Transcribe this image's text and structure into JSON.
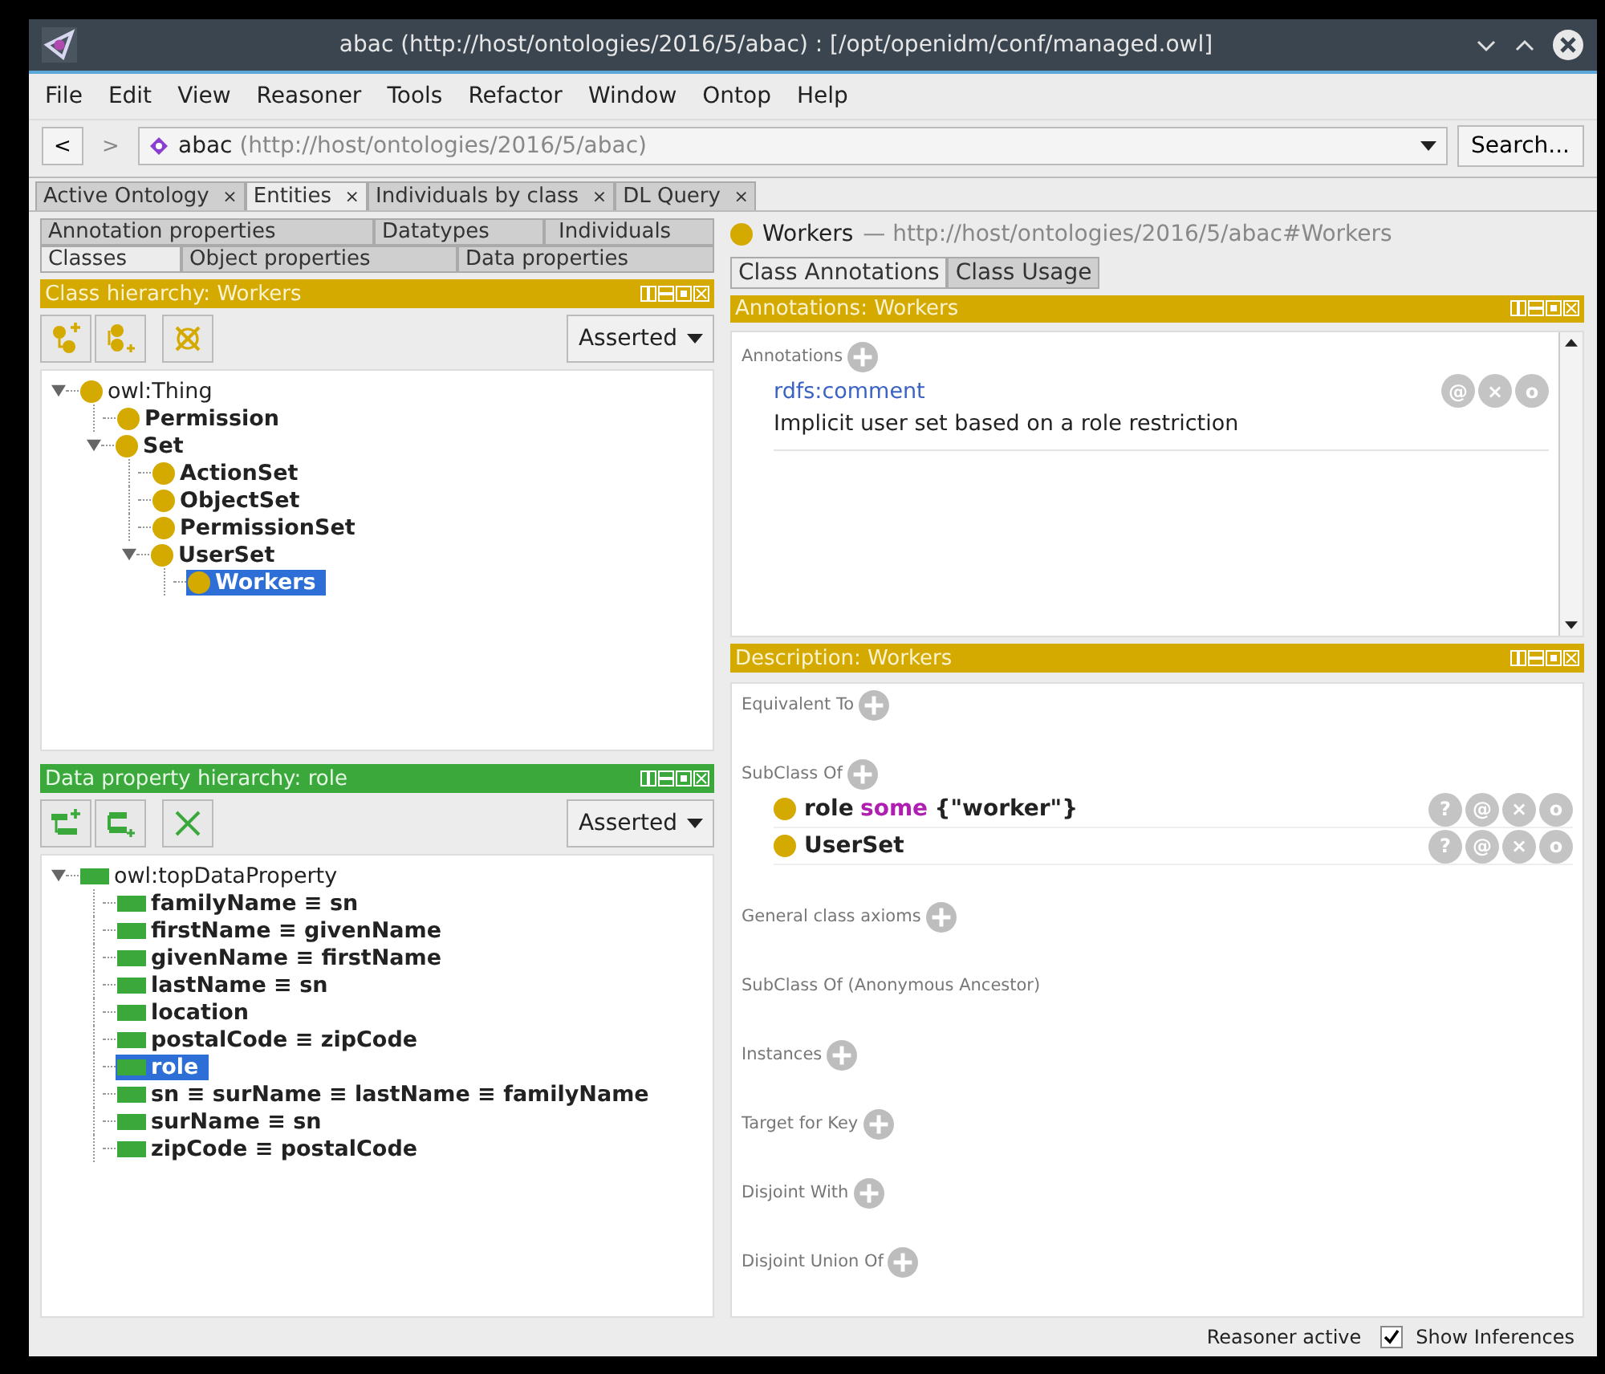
{
  "window": {
    "title": "abac (http://host/ontologies/2016/5/abac)  : [/opt/openidm/conf/managed.owl]"
  },
  "menu": [
    "File",
    "Edit",
    "View",
    "Reasoner",
    "Tools",
    "Refactor",
    "Window",
    "Ontop",
    "Help"
  ],
  "nav": {
    "back": "<",
    "forward": ">",
    "forward_disabled": true,
    "ontology_name": "abac",
    "ontology_iri": "(http://host/ontologies/2016/5/abac)",
    "search": "Search..."
  },
  "workspace_tabs": [
    {
      "label": "Active Ontology",
      "close": "×",
      "selected": false
    },
    {
      "label": "Entities",
      "close": "×",
      "selected": true
    },
    {
      "label": "Individuals by class",
      "close": "×",
      "selected": false
    },
    {
      "label": "DL Query",
      "close": "×",
      "selected": false
    }
  ],
  "entity_tabs": [
    [
      {
        "label": "Annotation properties",
        "selected": false
      },
      {
        "label": "Datatypes",
        "selected": false
      },
      {
        "label": "Individuals",
        "selected": false
      }
    ],
    [
      {
        "label": "Classes",
        "selected": true
      },
      {
        "label": "Object properties",
        "selected": false
      },
      {
        "label": "Data properties",
        "selected": false
      }
    ]
  ],
  "class_hierarchy": {
    "title": "Class hierarchy: Workers",
    "view": "Asserted",
    "tree": [
      {
        "label": "owl:Thing",
        "bold": false,
        "selected": false,
        "expanded": true,
        "children": [
          {
            "label": "Permission",
            "bold": true,
            "selected": false
          },
          {
            "label": "Set",
            "bold": true,
            "selected": false,
            "expanded": true,
            "children": [
              {
                "label": "ActionSet",
                "bold": true,
                "selected": false
              },
              {
                "label": "ObjectSet",
                "bold": true,
                "selected": false
              },
              {
                "label": "PermissionSet",
                "bold": true,
                "selected": false
              },
              {
                "label": "UserSet",
                "bold": true,
                "selected": false,
                "expanded": true,
                "children": [
                  {
                    "label": "Workers",
                    "bold": true,
                    "selected": true
                  }
                ]
              }
            ]
          }
        ]
      }
    ]
  },
  "data_property_hierarchy": {
    "title": "Data property hierarchy: role",
    "view": "Asserted",
    "tree": [
      {
        "label": "owl:topDataProperty",
        "bold": false,
        "selected": false,
        "expanded": true,
        "children": [
          {
            "label": "familyName ≡ sn",
            "bold": true,
            "selected": false
          },
          {
            "label": "firstName ≡ givenName",
            "bold": true,
            "selected": false
          },
          {
            "label": "givenName ≡ firstName",
            "bold": true,
            "selected": false
          },
          {
            "label": "lastName ≡ sn",
            "bold": true,
            "selected": false
          },
          {
            "label": "location",
            "bold": true,
            "selected": false
          },
          {
            "label": "postalCode ≡ zipCode",
            "bold": true,
            "selected": false
          },
          {
            "label": "role",
            "bold": true,
            "selected": true
          },
          {
            "label": "sn ≡ surName ≡ lastName ≡ familyName",
            "bold": true,
            "selected": false
          },
          {
            "label": "surName ≡ sn",
            "bold": true,
            "selected": false
          },
          {
            "label": "zipCode ≡ postalCode",
            "bold": true,
            "selected": false
          }
        ]
      }
    ]
  },
  "entity": {
    "name": "Workers",
    "iri": "— http://host/ontologies/2016/5/abac#Workers"
  },
  "detail_tabs": [
    {
      "label": "Class Annotations",
      "selected": true
    },
    {
      "label": "Class Usage",
      "selected": false
    }
  ],
  "annotations": {
    "title": "Annotations: Workers",
    "label": "Annotations",
    "items": [
      {
        "property": "rdfs:comment",
        "value": "Implicit user set based on a role restriction",
        "actions": [
          "@",
          "×",
          "o"
        ]
      }
    ]
  },
  "description": {
    "title": "Description: Workers",
    "sections": [
      {
        "label": "Equivalent To",
        "addable": true
      },
      {
        "label": "SubClass Of",
        "addable": true,
        "items": [
          {
            "segments": [
              {
                "text": "role",
                "kind": "name"
              },
              {
                "text": "some",
                "kind": "keyword"
              },
              {
                "text": "{\"worker\"}",
                "kind": "name"
              }
            ],
            "actions": [
              "?",
              "@",
              "×",
              "o"
            ]
          },
          {
            "segments": [
              {
                "text": "UserSet",
                "kind": "name"
              }
            ],
            "actions": [
              "?",
              "@",
              "×",
              "o"
            ]
          }
        ]
      },
      {
        "label": "General class axioms",
        "addable": true
      },
      {
        "label": "SubClass Of (Anonymous Ancestor)",
        "addable": false
      },
      {
        "label": "Instances",
        "addable": true
      },
      {
        "label": "Target for Key",
        "addable": true
      },
      {
        "label": "Disjoint With",
        "addable": true
      },
      {
        "label": "Disjoint Union Of",
        "addable": true
      }
    ]
  },
  "status": {
    "reasoner": "Reasoner active",
    "show_inferences": {
      "label": "Show Inferences",
      "checked": true
    }
  }
}
